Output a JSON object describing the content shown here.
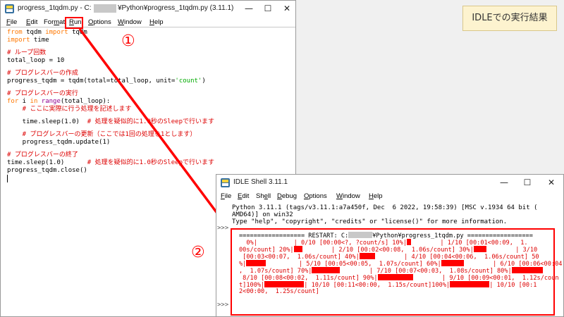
{
  "editor": {
    "title_prefix": "progress_1tqdm.py - C:",
    "title_suffix": "¥Python¥progress_1tqdm.py (3.11.1)",
    "controls": {
      "minimize": "—",
      "maximize": "☐",
      "close": "✕"
    },
    "menu": [
      "File",
      "Edit",
      "Format",
      "Run",
      "Options",
      "Window",
      "Help"
    ],
    "menu_underline": [
      "F",
      "E",
      "m",
      "R",
      "O",
      "W",
      "H"
    ],
    "code": {
      "l1_kw": "from",
      "l1_mid": " tqdm ",
      "l1_kw2": "import",
      "l1_end": " tqdm",
      "l2_kw": "import",
      "l2_end": " time",
      "l4": "# ループ回数",
      "l5": "total_loop = 10",
      "l7": "# プログレスバーの作成",
      "l8_a": "progress_tqdm = tqdm(total=total_loop, unit=",
      "l8_s": "'count'",
      "l8_b": ")",
      "l10": "# プログレスバーの実行",
      "l11_kw": "for",
      "l11_a": " i ",
      "l11_kw2": "in",
      "l11_sp": " ",
      "l11_bi": "range",
      "l11_b": "(total_loop):",
      "l12": "    # ここに実際に行う処理を記述します",
      "l14_a": "    time.sleep(1.0)  ",
      "l14_c": "# 処理を疑似的に1.0秒のSleepで行います",
      "l16": "    # プログレスバーの更新（ここでは1回の処理を1とします）",
      "l17": "    progress_tqdm.update(1)",
      "l19": "# プログレスバーの終了",
      "l20_a": "time.sleep(1.0)      ",
      "l20_c": "# 処理を疑似的に1.0秒のSleepで行います",
      "l21": "progress_tqdm.close()"
    }
  },
  "label": "IDLEでの実行結果",
  "markers": {
    "one": "①",
    "two": "②"
  },
  "shell": {
    "title": "IDLE Shell 3.11.1",
    "controls": {
      "minimize": "—",
      "maximize": "☐",
      "close": "✕"
    },
    "menu": [
      "File",
      "Edit",
      "Shell",
      "Debug",
      "Options",
      "Window",
      "Help"
    ],
    "menu_underline": [
      "F",
      "E",
      "e",
      "D",
      "O",
      "W",
      "H"
    ],
    "prompts": [
      ">>>",
      ">>>"
    ],
    "header": [
      "Python 3.11.1 (tags/v3.11.1:a7a450f, Dec  6 2022, 19:58:39) [MSC v.1934 64 bit (",
      "AMD64)] on win32",
      "Type \"help\", \"copyright\", \"credits\" or \"license()\" for more information."
    ],
    "restart_a": "================== RESTART: C:",
    "restart_b": "¥Python¥progress_1tqdm.py ==================",
    "output": {
      "l1_a": "  0%|",
      "l1_b": "          | 0/10 [00:00<?, ?count/s] 10%|",
      "l1_c": "        | 1/10 [00:01<00:09,  1.",
      "l2_a": "00s/count] 20%|",
      "l2_b": "        | 2/10 [00:02<00:08,  1.06s/count] 30%|",
      "l2_c": "        | 3/10",
      "l3_a": " [00:03<00:07,  1.06s/count] 40%|",
      "l3_b": "        | 4/10 [00:04<00:06,  1.06s/count] 50",
      "l4_a": "%|",
      "l4_b": "         | 5/10 [00:05<00:05,  1.07s/count] 60%|",
      "l4_c": "        | 6/10 [00:06<00:04",
      "l5_a": ",  1.07s/count] 70%|",
      "l5_b": "        | 7/10 [00:07<00:03,  1.08s/count] 80%|",
      "l5_c": "        |",
      "l6_a": " 8/10 [00:08<00:02,  1.11s/count] 90%|",
      "l6_b": "        | 9/10 [00:09<00:01,  1.12s/coun",
      "l7_a": "t]100%|",
      "l7_b": "| 10/10 [00:11<00:00,  1.15s/count]100%|",
      "l7_c": "| 10/10 [00:1",
      "l8": "2<00:00,  1.25s/count]"
    }
  }
}
